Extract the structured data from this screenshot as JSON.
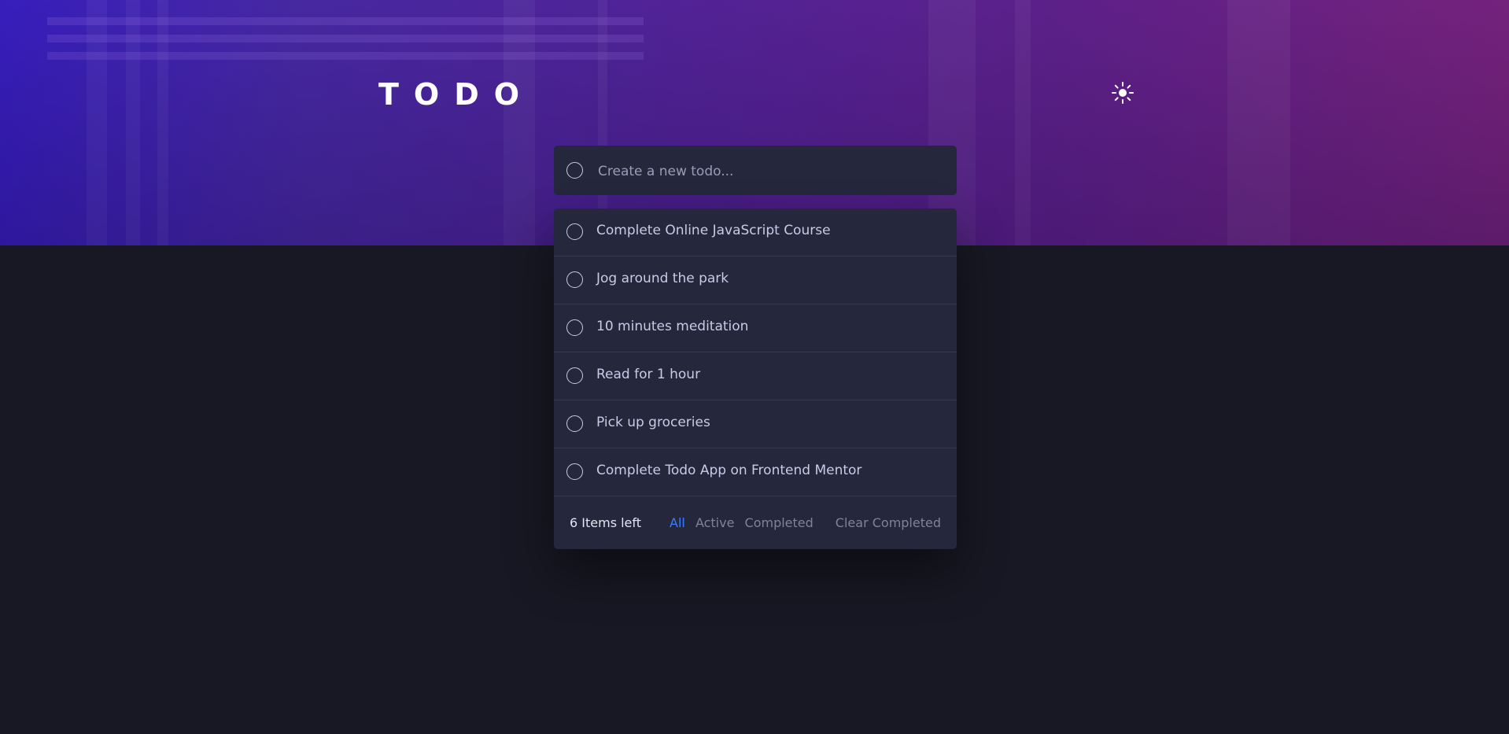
{
  "header": {
    "title": "TODO",
    "theme_icon": "sun-icon"
  },
  "new_todo": {
    "placeholder": "Create a new todo...",
    "value": ""
  },
  "todos": [
    {
      "text": "Complete Online JavaScript Course",
      "completed": false
    },
    {
      "text": "Jog around the park",
      "completed": false
    },
    {
      "text": "10 minutes meditation",
      "completed": false
    },
    {
      "text": "Read for 1 hour",
      "completed": false
    },
    {
      "text": "Pick up groceries",
      "completed": false
    },
    {
      "text": "Complete Todo App on Frontend Mentor",
      "completed": false
    }
  ],
  "footer": {
    "items_left": "6 Items left",
    "filters": [
      "All",
      "Active",
      "Completed"
    ],
    "active_filter": "All",
    "clear_label": "Clear Completed"
  },
  "colors": {
    "background": "#171823",
    "card": "#25273d",
    "text": "#c8cbe7",
    "muted": "#7f829e",
    "accent": "#3a7cfd",
    "divider": "#393a4b"
  }
}
